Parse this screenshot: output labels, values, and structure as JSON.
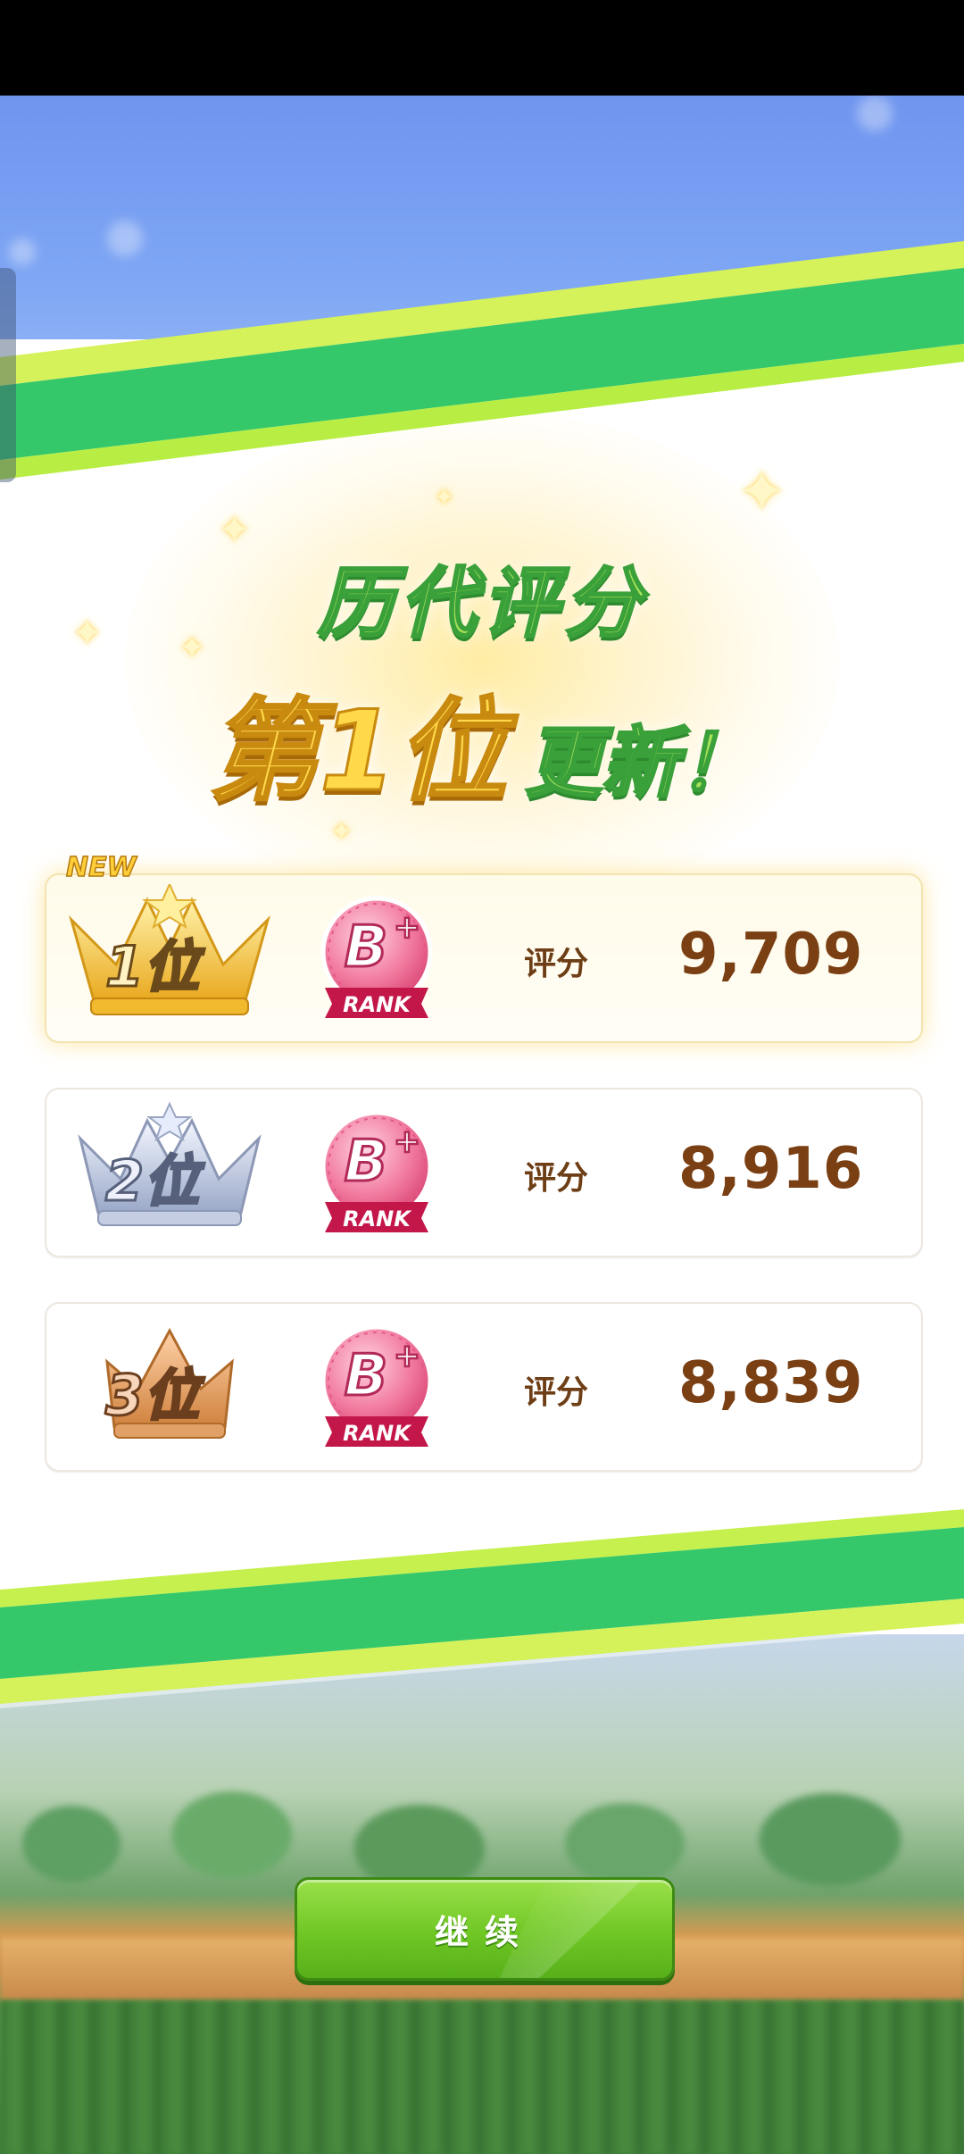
{
  "headline": {
    "line1": "历代评分",
    "line2_rank": "第1位",
    "line2_update": "更新！"
  },
  "colors": {
    "accent_green": "#6fc724",
    "gold": "#ffd94a",
    "score_brown": "#7a3f12",
    "rank_pink": "#e8527a"
  },
  "rankings": [
    {
      "new_tag": "NEW",
      "place": "1位",
      "crown": "gold-crown-icon",
      "grade": "B+",
      "grade_caption": "RANK",
      "score_label": "评分",
      "score": "9,709"
    },
    {
      "place": "2位",
      "crown": "silver-crown-icon",
      "grade": "B+",
      "grade_caption": "RANK",
      "score_label": "评分",
      "score": "8,916"
    },
    {
      "place": "3位",
      "crown": "bronze-crown-icon",
      "grade": "B+",
      "grade_caption": "RANK",
      "score_label": "评分",
      "score": "8,839"
    }
  ],
  "continue_button": {
    "label": "继续"
  }
}
